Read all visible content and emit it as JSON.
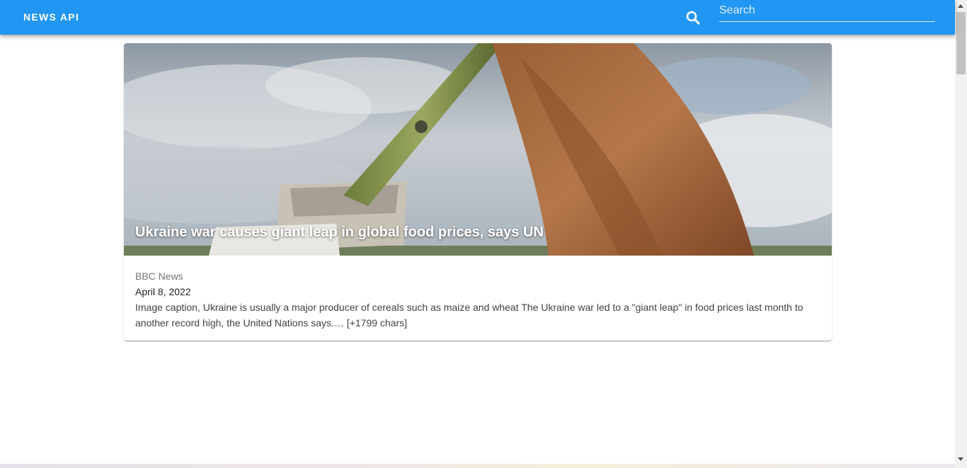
{
  "appbar": {
    "title": "NEWS API",
    "search_placeholder": "Search",
    "colors": {
      "bar": "#2196f3"
    }
  },
  "article": {
    "headline": "Ukraine war causes giant leap in global food prices, says UN",
    "source": "BBC News",
    "date": "April 8, 2022",
    "description": "Image caption, Ukraine is usually a major producer of cereals such as maize and wheat The Ukraine war led to a \"giant leap\" in food prices last month to another record high, the United Nations says.… [+1799 chars]"
  },
  "icons": {
    "search": "search-icon"
  }
}
